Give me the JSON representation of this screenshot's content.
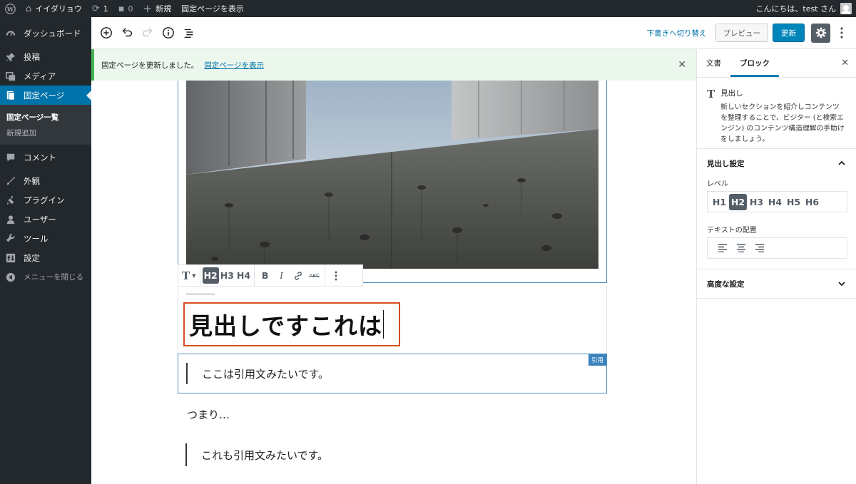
{
  "admin_bar": {
    "site_name": "イイダリョウ",
    "updates_count": "1",
    "comments_count": "0",
    "new_label": "新規",
    "view_page_label": "固定ページを表示",
    "greeting": "こんにちは、test さん"
  },
  "admin_menu": {
    "items": [
      {
        "label": "ダッシュボード",
        "icon": "dashboard-icon"
      },
      {
        "label": "投稿",
        "icon": "pin-icon"
      },
      {
        "label": "メディア",
        "icon": "media-icon"
      },
      {
        "label": "固定ページ",
        "icon": "page-icon"
      },
      {
        "label": "コメント",
        "icon": "comment-icon"
      },
      {
        "label": "外観",
        "icon": "brush-icon"
      },
      {
        "label": "プラグイン",
        "icon": "plugin-icon"
      },
      {
        "label": "ユーザー",
        "icon": "user-icon"
      },
      {
        "label": "ツール",
        "icon": "wrench-icon"
      },
      {
        "label": "設定",
        "icon": "settings-icon"
      }
    ],
    "submenu": [
      "固定ページ一覧",
      "新規追加"
    ],
    "collapse_label": "メニューを閉じる"
  },
  "editor_header": {
    "switch_to_draft": "下書きへ切り替え",
    "preview_label": "プレビュー",
    "update_label": "更新"
  },
  "notice": {
    "message": "固定ページを更新しました。",
    "link": "固定ページを表示"
  },
  "block_toolbar": {
    "heading_levels": [
      "H2",
      "H3",
      "H4"
    ],
    "active_level": "H2"
  },
  "content": {
    "heading": "見出しですこれは",
    "quote1": "ここは引用文みたいです。",
    "quote_block_label": "引用",
    "paragraph": "つまり…",
    "quote2": "これも引用文みたいです。"
  },
  "sidebar": {
    "tabs": [
      "文書",
      "ブロック"
    ],
    "active_tab": "ブロック",
    "block_title": "見出し",
    "block_description": "新しいセクションを紹介しコンテンツを整理することで、ビジター (と検索エンジン) のコンテンツ構造理解の手助けをしましょう。",
    "heading_settings_title": "見出し設定",
    "level_label": "レベル",
    "levels": [
      "H1",
      "H2",
      "H3",
      "H4",
      "H5",
      "H6"
    ],
    "active_level": "H2",
    "alignment_label": "テキストの配置",
    "advanced_title": "高度な設定"
  },
  "colors": {
    "admin_dark": "#23282d",
    "accent_blue": "#0073aa",
    "heading_highlight": "#d54e21",
    "notice_green": "#46b450"
  }
}
